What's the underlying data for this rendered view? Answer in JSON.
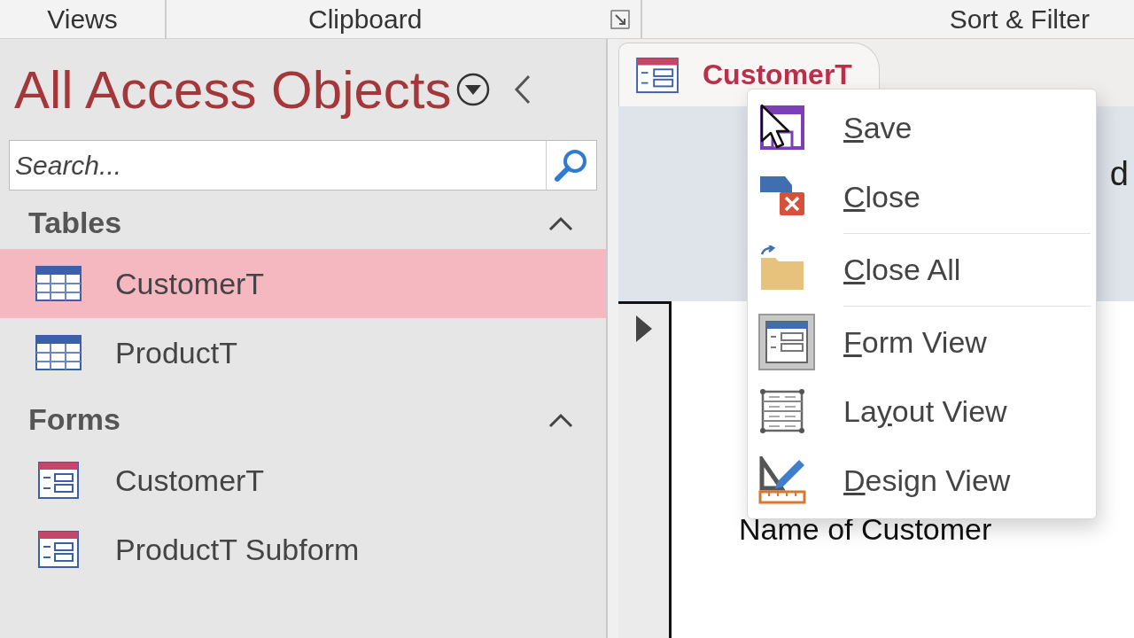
{
  "ribbon": {
    "groups": [
      {
        "label": "Views",
        "launcher": false
      },
      {
        "label": "Clipboard",
        "launcher": true
      },
      {
        "label": "Sort & Filter",
        "launcher": false
      }
    ]
  },
  "nav_pane": {
    "title": "All Access Objects",
    "search": {
      "placeholder": "Search..."
    },
    "groups": [
      {
        "label": "Tables",
        "expanded": true,
        "items": [
          {
            "label": "CustomerT",
            "kind": "table",
            "selected": true
          },
          {
            "label": "ProductT",
            "kind": "table",
            "selected": false
          }
        ]
      },
      {
        "label": "Forms",
        "expanded": true,
        "items": [
          {
            "label": "CustomerT",
            "kind": "form",
            "selected": false
          },
          {
            "label": "ProductT Subform",
            "kind": "form",
            "selected": false
          }
        ]
      }
    ]
  },
  "document": {
    "tab": {
      "label": "CustomerT",
      "kind": "form"
    },
    "edge_text": "d",
    "field_label": "Name of Customer"
  },
  "context_menu": {
    "items": [
      {
        "key": "S",
        "after": "ave",
        "kind": "save"
      },
      {
        "key": "C",
        "after": "lose",
        "kind": "close"
      },
      {
        "kind": "separator"
      },
      {
        "key": "C",
        "after": "lose All",
        "kind": "close_all"
      },
      {
        "kind": "separator"
      },
      {
        "key": "F",
        "after": "orm View",
        "kind": "form_view"
      },
      {
        "before": "La",
        "key": "y",
        "after": "out View",
        "kind": "layout_view"
      },
      {
        "key": "D",
        "after": "esign View",
        "kind": "design_view"
      }
    ]
  }
}
